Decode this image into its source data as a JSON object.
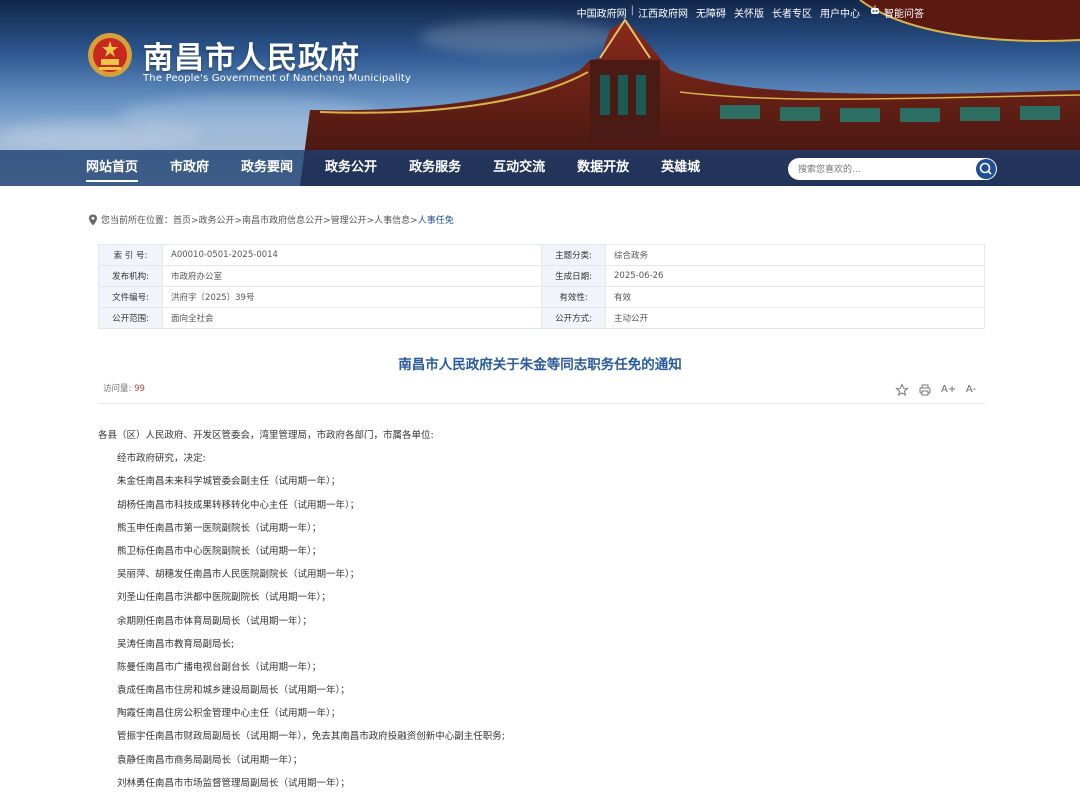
{
  "header": {
    "title": "南昌市人民政府",
    "subtitle": "The People's Government of Nanchang Municipality",
    "top_links": [
      "中国政府网",
      "江西政府网",
      "无障碍",
      "关怀版",
      "长者专区",
      "用户中心"
    ],
    "top_separator": "|",
    "ai_link": "智能问答"
  },
  "nav": {
    "items": [
      "网站首页",
      "市政府",
      "政务要闻",
      "政务公开",
      "政务服务",
      "互动交流",
      "数据开放",
      "英雄城"
    ],
    "search_placeholder": "搜索您喜欢的..."
  },
  "breadcrumb": {
    "prefix": "您当前所在位置：",
    "path": "首页>政务公开>南昌市政府信息公开>管理公开>人事信息>",
    "current": "人事任免"
  },
  "meta": {
    "rows": [
      {
        "k1": "索 引 号:",
        "v1": "A00010-0501-2025-0014",
        "k2": "主题分类:",
        "v2": "综合政务"
      },
      {
        "k1": "发布机构:",
        "v1": "市政府办公室",
        "k2": "生成日期:",
        "v2": "2025-06-26"
      },
      {
        "k1": "文件编号:",
        "v1": "洪府字〔2025〕39号",
        "k2": "有效性:",
        "v2": "有效"
      },
      {
        "k1": "公开范围:",
        "v1": "面向全社会",
        "k2": "公开方式:",
        "v2": "主动公开"
      }
    ]
  },
  "article": {
    "title": "南昌市人民政府关于朱金等同志职务任免的通知",
    "visits_label": "访问量:",
    "visits_count": "99",
    "tools": [
      "收藏",
      "打印",
      "A+",
      "A-"
    ],
    "paragraphs": [
      "各县（区）人民政府、开发区管委会，湾里管理局，市政府各部门，市属各单位:",
      "经市政府研究，决定:",
      "朱金任南昌未来科学城管委会副主任（试用期一年）；",
      "胡杨任南昌市科技成果转移转化中心主任（试用期一年）；",
      "熊玉申任南昌市第一医院副院长（试用期一年）；",
      "熊卫标任南昌市中心医院副院长（试用期一年）；",
      "吴丽萍、胡穗发任南昌市人民医院副院长（试用期一年）；",
      "刘圣山任南昌市洪都中医院副院长（试用期一年）；",
      "余期刚任南昌市体育局副局长（试用期一年）；",
      "吴涛任南昌市教育局副局长;",
      "陈曼任南昌市广播电视台副台长（试用期一年）；",
      "袁成任南昌市住房和城乡建设局副局长（试用期一年）；",
      "陶霞任南昌住房公积金管理中心主任（试用期一年）；",
      "管振宇任南昌市财政局副局长（试用期一年），免去其南昌市政府投融资创新中心副主任职务;",
      "袁静任南昌市商务局副局长（试用期一年）；",
      "刘林勇任南昌市市场监督管理局副局长（试用期一年）；"
    ]
  },
  "colors": {
    "nav_bg": "#1b3d70",
    "title_blue": "#2a5a9c",
    "visit_count": "#b4492e"
  }
}
